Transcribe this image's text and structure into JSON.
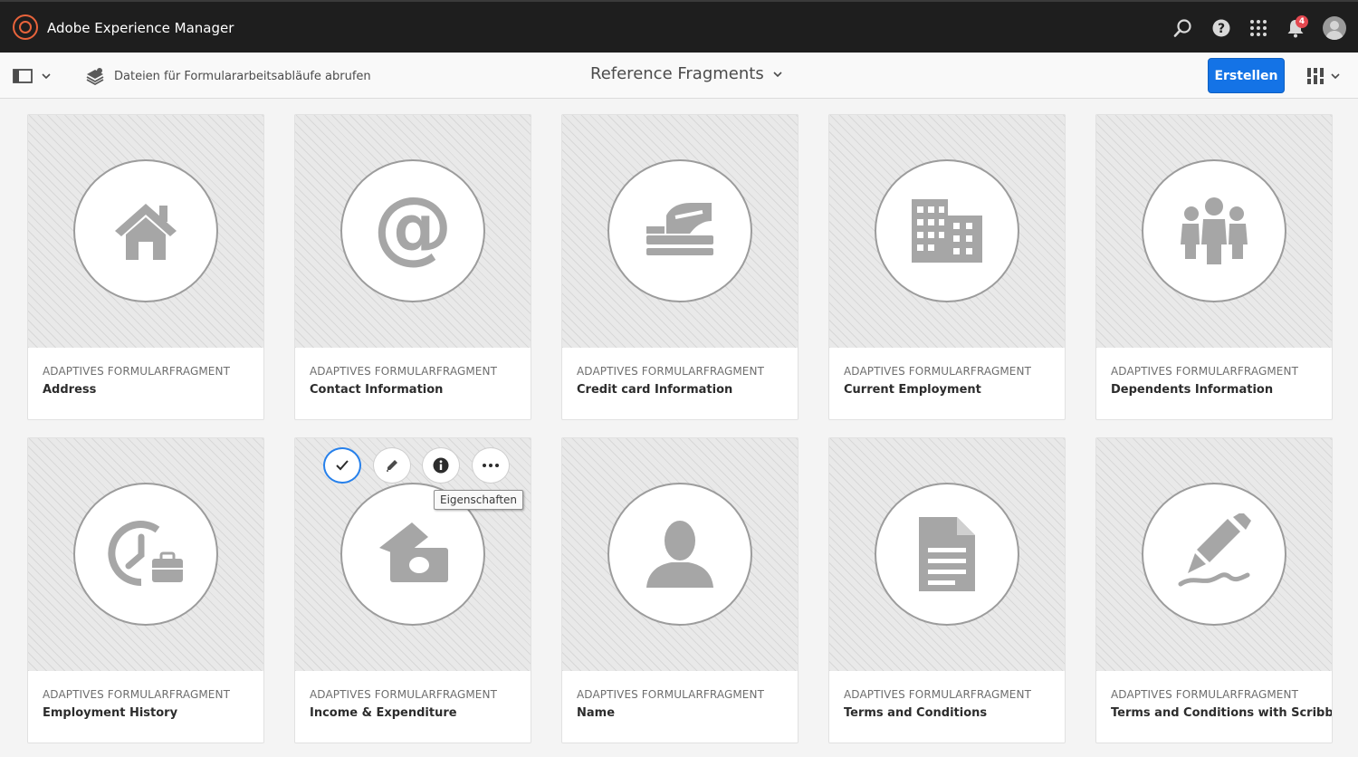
{
  "app": {
    "title": "Adobe Experience Manager",
    "notification_count": "4"
  },
  "header_icons": [
    "search-icon",
    "help-icon",
    "apps-grid-icon",
    "bell-icon",
    "avatar"
  ],
  "toolbar": {
    "workflow_link": "Dateien für Formulararbeitsabläufe abrufen",
    "title": "Reference Fragments",
    "create_label": "Erstellen"
  },
  "colors": {
    "accent": "#1473e6",
    "topbar": "#1e1e1e",
    "icon_gray": "#a6a6a6",
    "badge": "#e34850"
  },
  "cards": [
    {
      "type": "ADAPTIVES FORMULARFRAGMENT",
      "title": "Address",
      "icon": "home-icon"
    },
    {
      "type": "ADAPTIVES FORMULARFRAGMENT",
      "title": "Contact Information",
      "icon": "at-sign-icon"
    },
    {
      "type": "ADAPTIVES FORMULARFRAGMENT",
      "title": "Credit card Information",
      "icon": "credit-card-hand-icon"
    },
    {
      "type": "ADAPTIVES FORMULARFRAGMENT",
      "title": "Current Employment",
      "icon": "building-icon"
    },
    {
      "type": "ADAPTIVES FORMULARFRAGMENT",
      "title": "Dependents Information",
      "icon": "group-icon"
    },
    {
      "type": "ADAPTIVES FORMULARFRAGMENT",
      "title": "Employment History",
      "icon": "clock-briefcase-icon"
    },
    {
      "type": "ADAPTIVES FORMULARFRAGMENT",
      "title": "Income & Expenditure",
      "icon": "money-icon"
    },
    {
      "type": "ADAPTIVES FORMULARFRAGMENT",
      "title": "Name",
      "icon": "user-icon"
    },
    {
      "type": "ADAPTIVES FORMULARFRAGMENT",
      "title": "Terms and Conditions",
      "icon": "document-icon"
    },
    {
      "type": "ADAPTIVES FORMULARFRAGMENT",
      "title": "Terms and Conditions with Scribble",
      "icon": "signature-pen-icon"
    }
  ],
  "quick_actions": [
    "select-icon",
    "edit-icon",
    "info-icon",
    "more-icon"
  ],
  "tooltip": "Eigenschaften"
}
